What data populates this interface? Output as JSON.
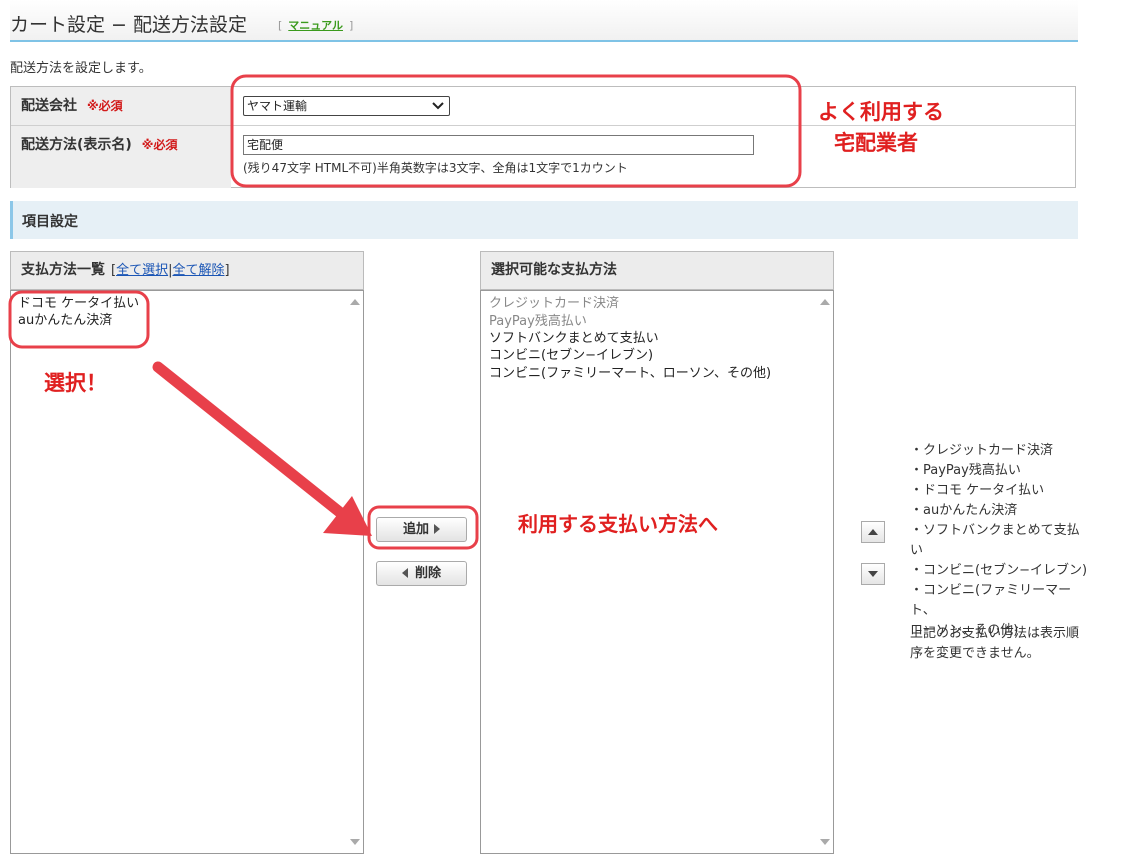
{
  "header": {
    "title": "カート設定 − 配送方法設定",
    "bracket_open": "[",
    "manual_link": "マニュアル",
    "bracket_close": "]"
  },
  "description": "配送方法を設定します。",
  "form": {
    "company_label": "配送会社",
    "method_label": "配送方法(表示名)",
    "required_mark": "※必須",
    "company_value": "ヤマト運輸",
    "method_value": "宅配便",
    "method_hint": "(残り47文字 HTML不可)半角英数字は3文字、全角は1文字で1カウント"
  },
  "section_title": "項目設定",
  "left_panel": {
    "title": "支払方法一覧",
    "select_all": "全て選択",
    "deselect_all": "全て解除",
    "items": [
      "ドコモ ケータイ払い",
      "auかんたん決済"
    ]
  },
  "right_panel": {
    "title": "選択可能な支払方法",
    "items": [
      {
        "label": "クレジットカード決済",
        "muted": true
      },
      {
        "label": "PayPay残高払い",
        "muted": true
      },
      {
        "label": "ソフトバンクまとめて支払い",
        "muted": false
      },
      {
        "label": "コンビニ(セブン−イレブン)",
        "muted": false
      },
      {
        "label": "コンビニ(ファミリーマート、ローソン、その他)",
        "muted": false
      }
    ]
  },
  "buttons": {
    "add": "追加",
    "delete": "削除"
  },
  "order_list": [
    "・クレジットカード決済",
    "・PayPay残高払い",
    "・ドコモ ケータイ払い",
    "・auかんたん決済",
    "・ソフトバンクまとめて支払い",
    "・コンビニ(セブン−イレブン)",
    "・コンビニ(ファミリーマート、",
    "ローソン、その他)"
  ],
  "order_note": "上記のお支払い方法は表示順序を変更できません。",
  "annotations": {
    "carrier_line1": "よく利用する",
    "carrier_line2": "宅配業者",
    "select": "選択！",
    "to_methods": "利用する支払い方法へ",
    "color": "#e8404a"
  }
}
